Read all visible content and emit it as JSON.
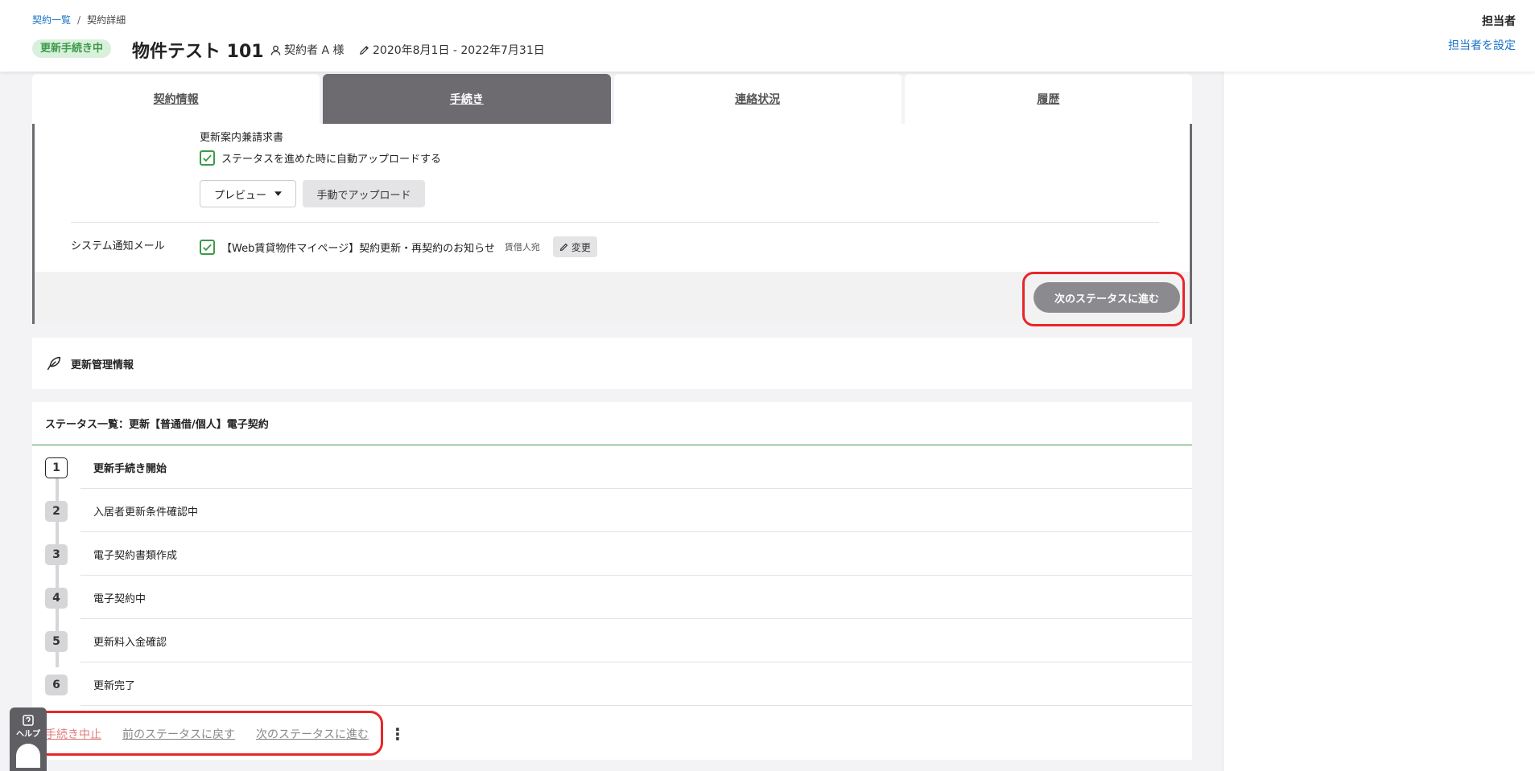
{
  "breadcrumb": {
    "parent": "契約一覧",
    "current": "契約詳細"
  },
  "header": {
    "status_badge": "更新手続き中",
    "title": "物件テスト 101",
    "contractor": "契約者 A 様",
    "period": "2020年8月1日 - 2022年7月31日",
    "assignee_label": "担当者",
    "assignee_link": "担当者を設定"
  },
  "tabs": [
    {
      "label": "契約情報"
    },
    {
      "label": "手続き"
    },
    {
      "label": "連絡状況"
    },
    {
      "label": "履歴"
    }
  ],
  "procedure": {
    "document_title": "更新案内兼請求書",
    "auto_upload_label": "ステータスを進めた時に自動アップロードする",
    "preview_label": "プレビュー",
    "manual_upload_label": "手動でアップロード",
    "mail_label": "システム通知メール",
    "mail_subject": "【Web賃貸物件マイページ】契約更新・再契約のお知らせ",
    "mail_recipient": "賃借人宛",
    "change_label": "変更",
    "next_status_label": "次のステータスに進む"
  },
  "management": {
    "title": "更新管理情報"
  },
  "status_list": {
    "heading": "ステータス一覧：更新【普通借/個人】電子契約",
    "steps": [
      {
        "num": "1",
        "label": "更新手続き開始"
      },
      {
        "num": "2",
        "label": "入居者更新条件確認中"
      },
      {
        "num": "3",
        "label": "電子契約書類作成"
      },
      {
        "num": "4",
        "label": "電子契約中"
      },
      {
        "num": "5",
        "label": "更新料入金確認"
      },
      {
        "num": "6",
        "label": "更新完了"
      }
    ],
    "actions": {
      "abort": "手続き中止",
      "prev": "前のステータスに戻す",
      "next": "次のステータスに進む"
    }
  },
  "help": {
    "label": "ヘルプ"
  },
  "colors": {
    "accent": "#3d9a4a",
    "link": "#1a73c8",
    "highlight": "#e8262a",
    "active_tab": "#6d6a70"
  }
}
